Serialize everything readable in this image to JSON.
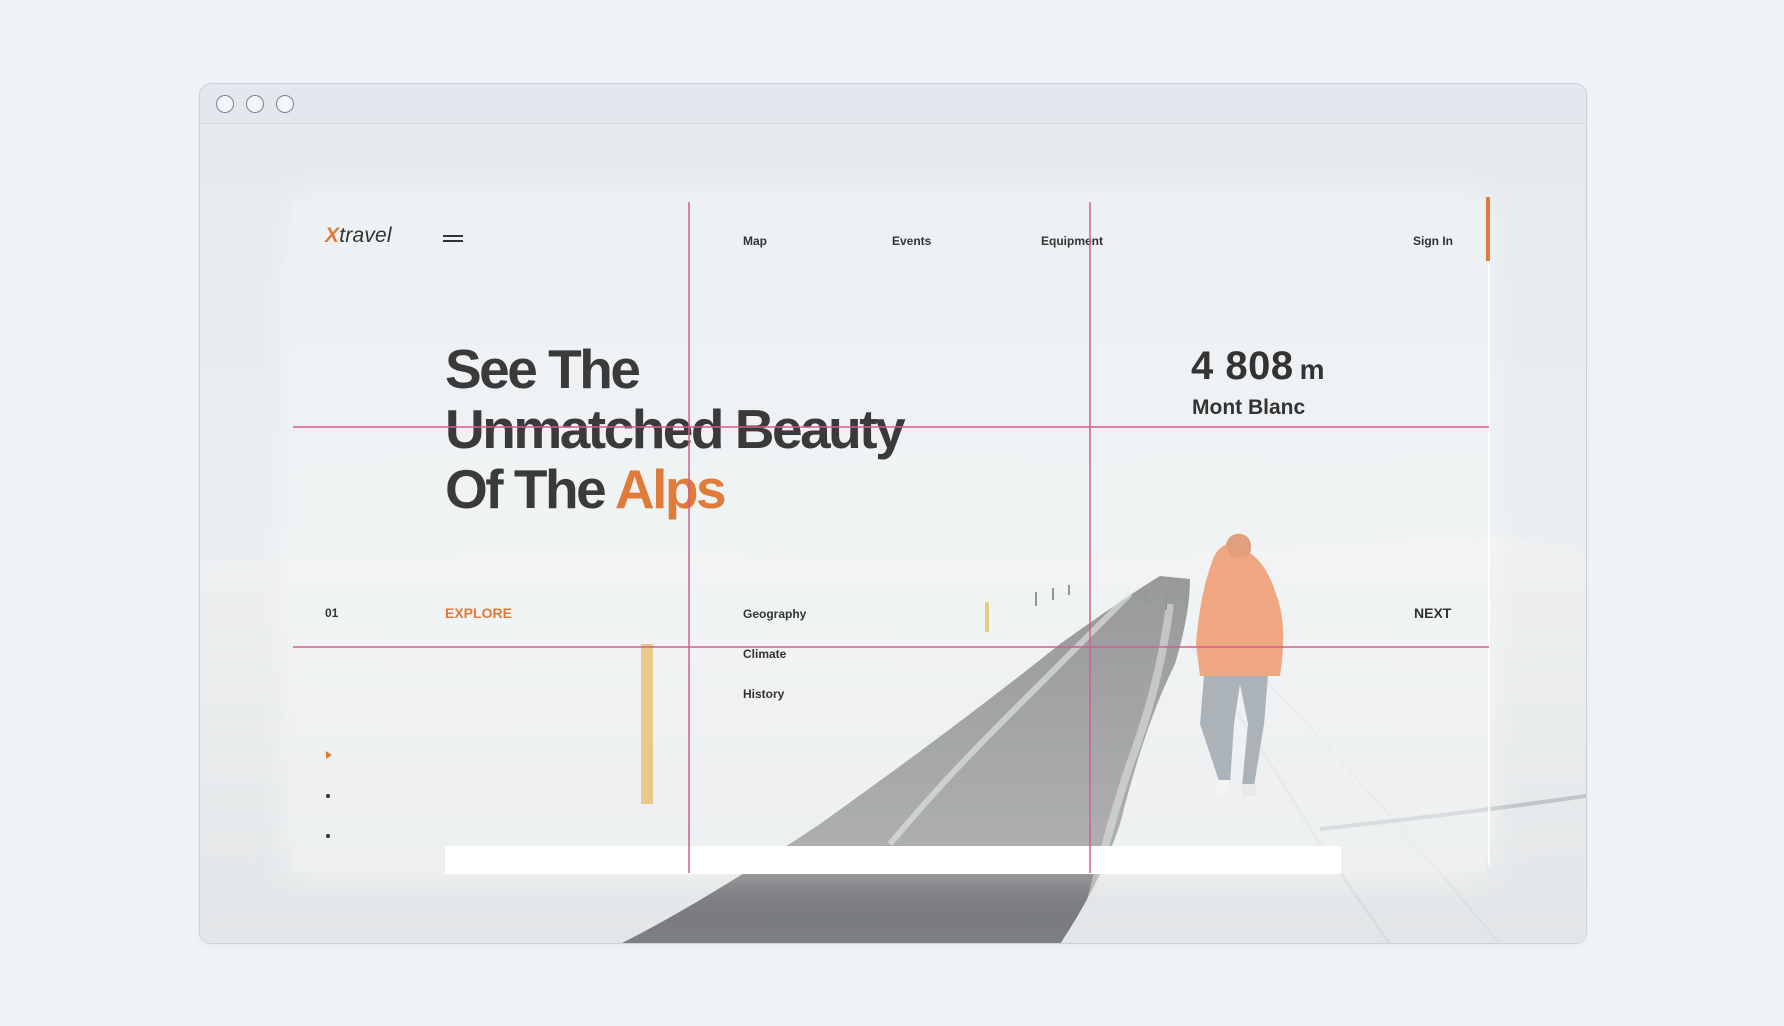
{
  "site": {
    "logo_x": "X",
    "logo_rest": "travel"
  },
  "nav": {
    "items": [
      "Map",
      "Events",
      "Equipment"
    ],
    "signin": "Sign In"
  },
  "hero": {
    "line1": "See The",
    "line2": "Unmatched Beauty",
    "line3_prefix": "Of The ",
    "line3_highlight": "Alps"
  },
  "stat": {
    "value": "4 808",
    "unit": "m",
    "name": "Mont Blanc"
  },
  "footer_row": {
    "index": "01",
    "explore": "EXPLORE",
    "next": "NEXT",
    "sublinks": [
      "Geography",
      "Climate",
      "History"
    ]
  },
  "colors": {
    "accent": "#e07b39",
    "gridline": "#d65c8c",
    "text": "#333333"
  }
}
